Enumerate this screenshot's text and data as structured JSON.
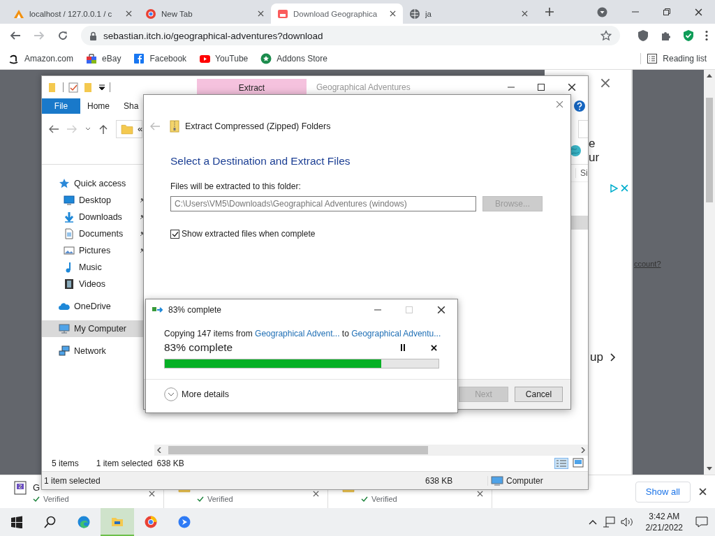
{
  "browser": {
    "tabs": [
      {
        "title": "localhost / 127.0.0.1 / c",
        "selected": false
      },
      {
        "title": "New Tab",
        "selected": false
      },
      {
        "title": "Download Geographica",
        "selected": true
      },
      {
        "title": "ja",
        "selected": false
      }
    ],
    "address": "sebastian.itch.io/geographical-adventures?download",
    "bookmarks": [
      "Amazon.com",
      "eBay",
      "Facebook",
      "YouTube",
      "Addons Store"
    ],
    "reading_list": "Reading list"
  },
  "web_page": {
    "heading_fragments": [
      "e",
      "ur"
    ],
    "link_fragment": "ccount?",
    "signup_fragment": "up"
  },
  "explorer": {
    "context_tab": "Extract",
    "title": "Geographical Adventures",
    "ribbon_tabs": [
      {
        "label": "File",
        "selected": true
      },
      {
        "label": "Home",
        "selected": false
      },
      {
        "label": "Sha",
        "selected": false
      }
    ],
    "breadcrumb": "«",
    "column_fragment": "Si",
    "nav": [
      {
        "label": "Quick access",
        "selected": false,
        "children": [
          {
            "label": "Desktop",
            "selected": false,
            "pinned": true
          },
          {
            "label": "Downloads",
            "selected": false,
            "pinned": true
          },
          {
            "label": "Documents",
            "selected": false,
            "pinned": true
          },
          {
            "label": "Pictures",
            "selected": false,
            "pinned": true
          },
          {
            "label": "Music",
            "selected": false,
            "pinned": false
          },
          {
            "label": "Videos",
            "selected": false,
            "pinned": false
          }
        ]
      },
      {
        "label": "OneDrive",
        "selected": false
      },
      {
        "label": "My Computer",
        "selected": true
      },
      {
        "label": "Network",
        "selected": false
      }
    ],
    "status": [
      "5 items",
      "1 item selected",
      "638 KB"
    ],
    "status_behind": {
      "selection": "1 item selected",
      "size": "638 KB",
      "location": "Computer"
    }
  },
  "extract_dialog": {
    "title": "Extract Compressed (Zipped) Folders",
    "heading": "Select a Destination and Extract Files",
    "field_label": "Files will be extracted to this folder:",
    "path": "C:\\Users\\VM5\\Downloads\\Geographical Adventures (windows)",
    "browse": {
      "label": "Browse...",
      "disabled": true
    },
    "show_files": {
      "label": "Show extracted files when complete",
      "checked": true
    },
    "buttons": [
      {
        "label": "Next",
        "disabled": true
      },
      {
        "label": "Cancel",
        "disabled": false
      }
    ]
  },
  "progress_dialog": {
    "title": "83% complete",
    "copying": "Copying 147 items from",
    "source": "Geographical Advent...",
    "to": "to",
    "destination": "Geographical Adventu...",
    "status": "83% complete",
    "level": 0.79,
    "more_details": "More details"
  },
  "downloads": [
    {
      "name": "G",
      "status": "Verified"
    },
    {
      "status": "Verified"
    },
    {
      "status": "Verified"
    }
  ],
  "show_all": "Show all",
  "taskbar": {
    "time": "3:42 AM",
    "date": "2/21/2022"
  }
}
